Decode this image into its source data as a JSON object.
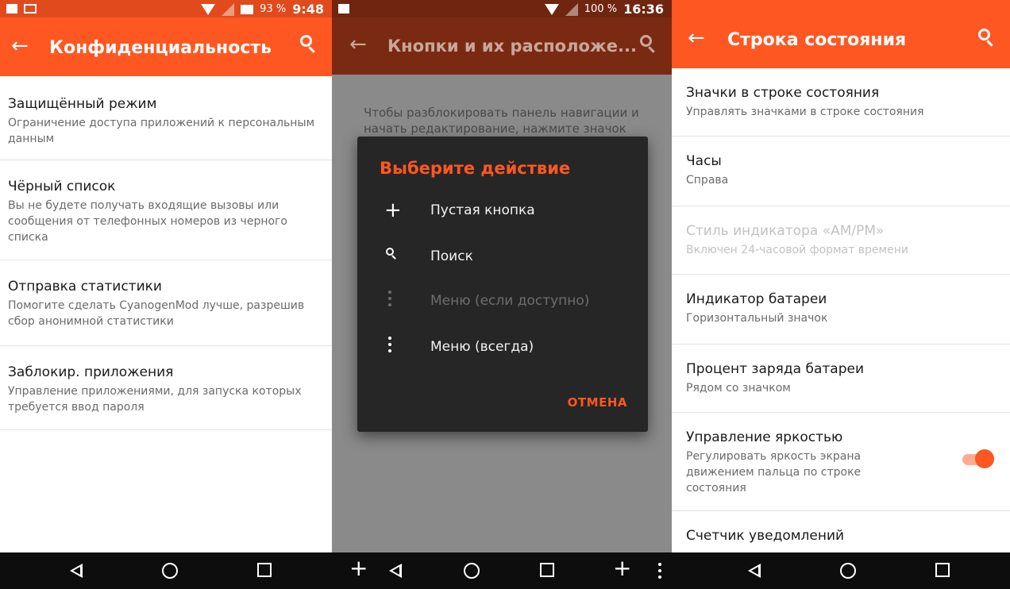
{
  "panel1": {
    "status": {
      "battery": "93 %",
      "time": "9:48"
    },
    "title": "Конфиденциальность",
    "items": [
      {
        "title": "Защищённый режим",
        "summary": "Ограничение доступа приложений к персональным данным"
      },
      {
        "title": "Чёрный список",
        "summary": "Вы не будете получать входящие вызовы или сообщения от телефонных номеров из черного списка"
      },
      {
        "title": "Отправка статистики",
        "summary": "Помогите сделать CyanogenMod лучше, разрешив сбор анонимной статистики"
      },
      {
        "title": "Заблокир. приложения",
        "summary": "Управление приложениями, для запуска которых требуется ввод пароля"
      }
    ]
  },
  "panel2": {
    "status": {
      "battery": "100 %",
      "time": "16:36"
    },
    "title": "Кнопки и их расположе...",
    "background_text": "Чтобы разблокировать панель навигации и начать редактирование, нажмите значок",
    "dialog": {
      "title": "Выберите действие",
      "options": [
        {
          "icon": "plus-icon",
          "label": "Пустая кнопка",
          "enabled": true
        },
        {
          "icon": "search-icon",
          "label": "Поиск",
          "enabled": true
        },
        {
          "icon": "menu-dots-icon",
          "label": "Меню (если доступно)",
          "enabled": false
        },
        {
          "icon": "menu-dots-icon",
          "label": "Меню (всегда)",
          "enabled": true
        }
      ],
      "cancel": "ОТМЕНА"
    }
  },
  "panel3": {
    "title": "Строка состояния",
    "items": [
      {
        "title": "Значки в строке состояния",
        "summary": "Управлять значками в строке состояния",
        "enabled": true
      },
      {
        "title": "Часы",
        "summary": "Справа",
        "enabled": true
      },
      {
        "title": "Стиль индикатора «AM/PM»",
        "summary": "Включен 24-часовой формат времени",
        "enabled": false
      },
      {
        "title": "Индикатор батареи",
        "summary": "Горизонтальный значок",
        "enabled": true
      },
      {
        "title": "Процент заряда батареи",
        "summary": "Рядом со значком",
        "enabled": true
      },
      {
        "title": "Управление яркостью",
        "summary": "Регулировать яркость экрана движением пальца по строке состояния",
        "enabled": true,
        "toggle": true
      },
      {
        "title": "Счетчик уведомлений",
        "summary": "",
        "enabled": true
      }
    ]
  },
  "colors": {
    "accent": "#ff5722",
    "statusbar": "#e04a1c",
    "navbar": "#0d0d0d"
  }
}
